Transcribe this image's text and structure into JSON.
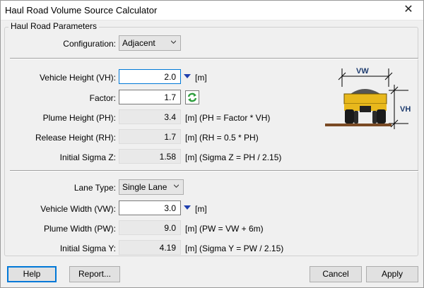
{
  "window": {
    "title": "Haul Road Volume Source Calculator"
  },
  "group": {
    "title": "Haul Road Parameters"
  },
  "configuration": {
    "label": "Configuration:",
    "value": "Adjacent"
  },
  "vehicle_height": {
    "label": "Vehicle Height (VH):",
    "value": "2.0",
    "unit": "[m]"
  },
  "factor": {
    "label": "Factor:",
    "value": "1.7"
  },
  "plume_height": {
    "label": "Plume Height (PH):",
    "value": "3.4",
    "note": "[m] (PH = Factor * VH)"
  },
  "release_height": {
    "label": "Release Height (RH):",
    "value": "1.7",
    "note": "[m] (RH = 0.5 * PH)"
  },
  "initial_sigma_z": {
    "label": "Initial Sigma Z:",
    "value": "1.58",
    "note": "[m] (Sigma Z = PH / 2.15)"
  },
  "lane_type": {
    "label": "Lane Type:",
    "value": "Single Lane"
  },
  "vehicle_width": {
    "label": "Vehicle Width (VW):",
    "value": "3.0",
    "unit": "[m]"
  },
  "plume_width": {
    "label": "Plume Width (PW):",
    "value": "9.0",
    "note": "[m] (PW = VW + 6m)"
  },
  "initial_sigma_y": {
    "label": "Initial Sigma Y:",
    "value": "4.19",
    "note": "[m] (Sigma Y = PW / 2.15)"
  },
  "diagram": {
    "vw_label": "VW",
    "vh_label": "VH"
  },
  "buttons": {
    "help": "Help",
    "report": "Report...",
    "cancel": "Cancel",
    "apply": "Apply"
  },
  "icons": {
    "close": "close-icon",
    "refresh": "refresh-icon",
    "dropdown": "chevron-down-icon",
    "spin": "triangle-down-icon"
  },
  "colors": {
    "accent": "#0078d7",
    "spin_arrow": "#1f3fae",
    "refresh_green": "#2e9e3e",
    "truck_yellow": "#e8b81c"
  }
}
